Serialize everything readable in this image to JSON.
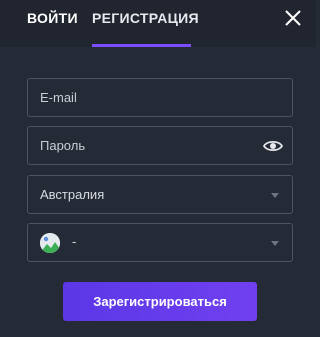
{
  "header": {
    "tabs": [
      {
        "label": "ВОЙТИ",
        "active": false
      },
      {
        "label": "РЕГИСТРАЦИЯ",
        "active": true
      }
    ],
    "close_icon": "close-icon",
    "accent_color": "#7c4dff"
  },
  "form": {
    "email": {
      "placeholder": "E-mail",
      "value": ""
    },
    "password": {
      "placeholder": "Пароль",
      "value": "",
      "icon": "eye-icon"
    },
    "country": {
      "selected": "Австралия",
      "icon": "chevron-down-icon"
    },
    "currency": {
      "selected": "-",
      "flag_icon": "flag-icon",
      "icon": "chevron-down-icon"
    },
    "submit_label": "Зарегистрироваться",
    "submit_color": "#6a3cf0"
  }
}
